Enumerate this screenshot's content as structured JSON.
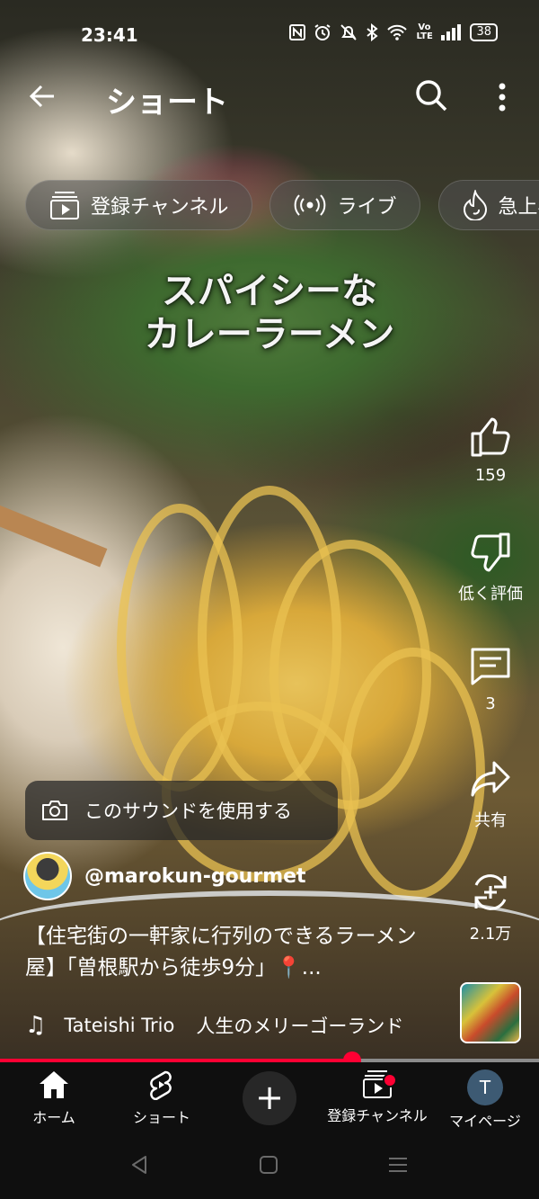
{
  "status_bar": {
    "time": "23:41",
    "icons": [
      "nfc-icon",
      "alarm-icon",
      "mute-icon",
      "bluetooth-icon",
      "wifi-icon",
      "volte-icon",
      "signal-icon"
    ],
    "volte_text": "Vo LTE",
    "battery": "38"
  },
  "topbar": {
    "title": "ショート",
    "back_icon": "back-arrow-icon",
    "search_icon": "search-icon",
    "more_icon": "more-vert-icon"
  },
  "chips": [
    {
      "label": "登録チャンネル",
      "icon": "subscriptions-icon"
    },
    {
      "label": "ライブ",
      "icon": "live-icon"
    },
    {
      "label": "急上昇",
      "icon": "trending-icon"
    }
  ],
  "video": {
    "overlay_title_line1": "スパイシーな",
    "overlay_title_line2": "カレーラーメン",
    "progress": 0.653
  },
  "actions": {
    "like_count": "159",
    "dislike_label": "低く評価",
    "comment_count": "3",
    "share_label": "共有",
    "remix_count": "2.1万"
  },
  "sound_button": "このサウンドを使用する",
  "channel": {
    "handle": "@marokun-gourmet"
  },
  "description": "【住宅街の一軒家に行列のできるラーメン屋】「曽根駅から徒歩9分」📍...",
  "music": {
    "artist": "Tateishi Trio",
    "track": "人生のメリーゴーランド"
  },
  "bottom_nav": {
    "home": "ホーム",
    "shorts": "ショート",
    "create": "+",
    "subscriptions": "登録チャンネル",
    "mypage": "マイページ",
    "avatar_letter": "T"
  },
  "colors": {
    "accent": "#ff0033",
    "nav_bg": "#0f0f0f"
  }
}
